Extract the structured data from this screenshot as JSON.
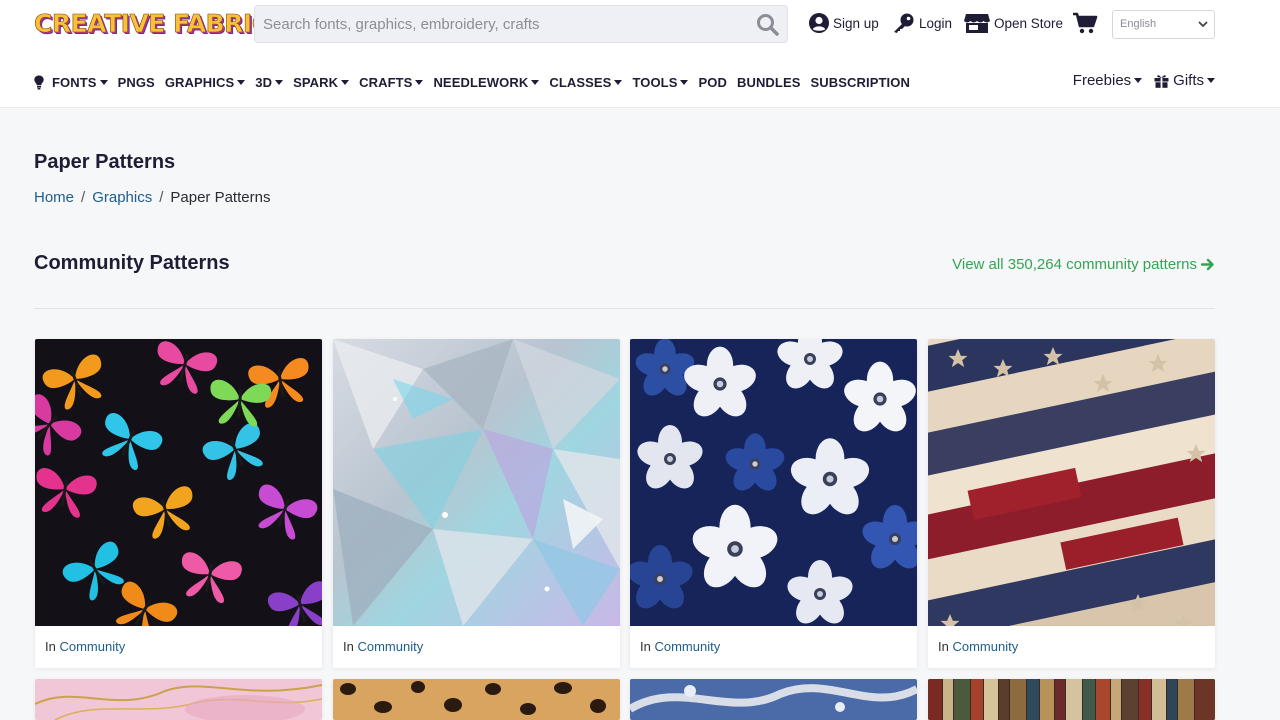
{
  "brand": {
    "logo_text": "CREATIVE FABRICA"
  },
  "search": {
    "placeholder": "Search fonts, graphics, embroidery, crafts"
  },
  "header_links": {
    "signup": "Sign up",
    "login": "Login",
    "open_store": "Open Store"
  },
  "language": {
    "selected": "English"
  },
  "nav": {
    "items": [
      {
        "label": "FONTS",
        "dropdown": true
      },
      {
        "label": "PNGS",
        "dropdown": false
      },
      {
        "label": "GRAPHICS",
        "dropdown": true
      },
      {
        "label": "3D",
        "dropdown": true
      },
      {
        "label": "SPARK",
        "dropdown": true
      },
      {
        "label": "CRAFTS",
        "dropdown": true
      },
      {
        "label": "NEEDLEWORK",
        "dropdown": true
      },
      {
        "label": "CLASSES",
        "dropdown": true
      },
      {
        "label": "TOOLS",
        "dropdown": true
      },
      {
        "label": "POD",
        "dropdown": false
      },
      {
        "label": "BUNDLES",
        "dropdown": false
      },
      {
        "label": "SUBSCRIPTION",
        "dropdown": false
      }
    ],
    "right": {
      "freebies": "Freebies",
      "gifts": "Gifts"
    }
  },
  "page": {
    "title": "Paper Patterns",
    "breadcrumb": {
      "home": "Home",
      "graphics": "Graphics",
      "current": "Paper Patterns",
      "separator": "/"
    }
  },
  "section": {
    "title": "Community Patterns",
    "view_all": "View all 350,264 community patterns"
  },
  "cards": [
    {
      "image": "colorful butterflies pattern",
      "prefix": "In",
      "category": "Community"
    },
    {
      "image": "holographic crystal shards pattern",
      "prefix": "In",
      "category": "Community"
    },
    {
      "image": "blue and white flowers pattern",
      "prefix": "In",
      "category": "Community"
    },
    {
      "image": "distressed american flag stars and stripes",
      "prefix": "In",
      "category": "Community"
    }
  ],
  "cards_row2": [
    {
      "image": "pink marble with gold veins"
    },
    {
      "image": "leopard print"
    },
    {
      "image": "blue silver ornate swirl"
    },
    {
      "image": "vintage bookshelf"
    }
  ],
  "colors": {
    "accent_green": "#36a354",
    "link_blue": "#1f5d8c",
    "text_dark": "#1f1d35"
  }
}
